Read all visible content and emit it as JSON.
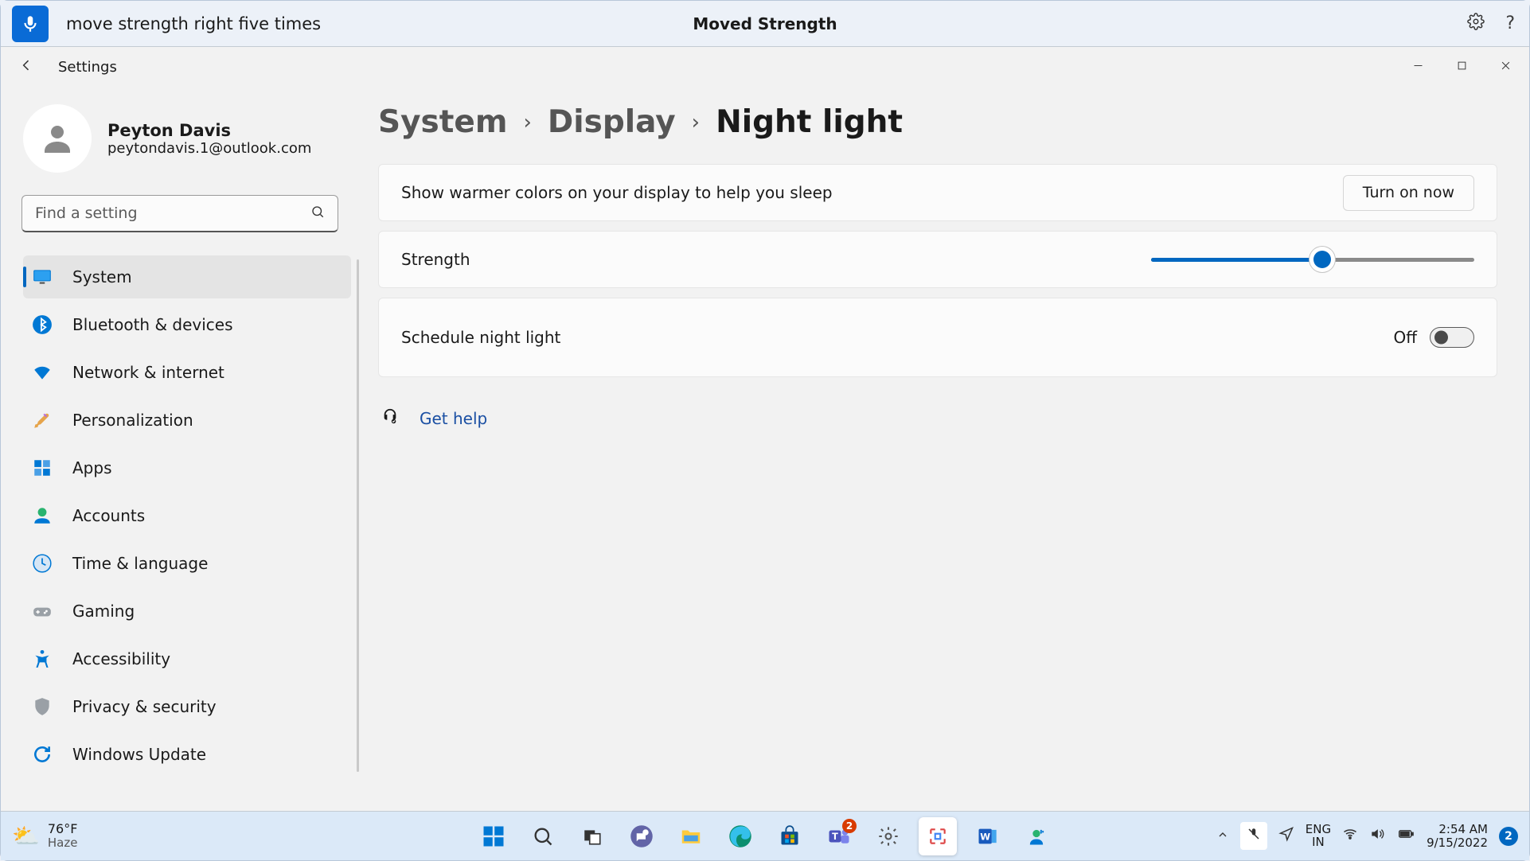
{
  "voiceBar": {
    "command": "move strength right five times",
    "title": "Moved Strength"
  },
  "chrome": {
    "appTitle": "Settings"
  },
  "user": {
    "name": "Peyton Davis",
    "email": "peytondavis.1@outlook.com"
  },
  "search": {
    "placeholder": "Find a setting"
  },
  "nav": {
    "items": [
      {
        "label": "System"
      },
      {
        "label": "Bluetooth & devices"
      },
      {
        "label": "Network & internet"
      },
      {
        "label": "Personalization"
      },
      {
        "label": "Apps"
      },
      {
        "label": "Accounts"
      },
      {
        "label": "Time & language"
      },
      {
        "label": "Gaming"
      },
      {
        "label": "Accessibility"
      },
      {
        "label": "Privacy & security"
      },
      {
        "label": "Windows Update"
      }
    ],
    "activeIndex": 0
  },
  "breadcrumb": {
    "level1": "System",
    "level2": "Display",
    "current": "Night light",
    "separator": "›"
  },
  "cards": {
    "info": {
      "text": "Show warmer colors on your display to help you sleep",
      "button": "Turn on now"
    },
    "strength": {
      "label": "Strength",
      "valuePercent": 53
    },
    "schedule": {
      "label": "Schedule night light",
      "state": "Off",
      "on": false
    }
  },
  "help": {
    "label": "Get help"
  },
  "taskbar": {
    "weather": {
      "temp": "76°F",
      "cond": "Haze"
    },
    "lang": {
      "l1": "ENG",
      "l2": "IN"
    },
    "clock": {
      "time": "2:54 AM",
      "date": "9/15/2022"
    },
    "notifications": "2",
    "teamsBadge": "2"
  }
}
